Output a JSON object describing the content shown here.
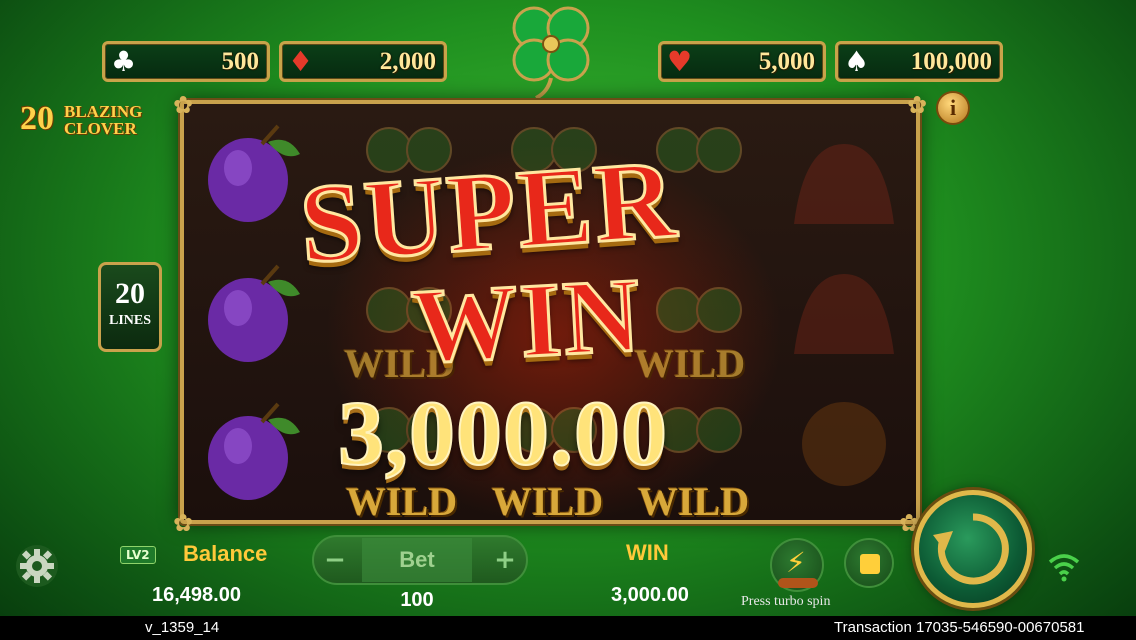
{
  "jackpots": [
    {
      "suit": "club-icon",
      "glyph": "♣",
      "color": "#ffffff",
      "value": "500"
    },
    {
      "suit": "diamond-icon",
      "glyph": "♦",
      "color": "#e53a2a",
      "value": "2,000"
    },
    {
      "suit": "heart-icon",
      "glyph": "♥",
      "color": "#e53a2a",
      "value": "5,000"
    },
    {
      "suit": "spade-icon",
      "glyph": "♠",
      "color": "#ffffff",
      "value": "100,000"
    }
  ],
  "logo": {
    "number": "20",
    "line1": "BLAZING",
    "line2": "CLOVER"
  },
  "lines": {
    "number": "20",
    "label": "LINES"
  },
  "info_label": "i",
  "reels": {
    "wild_labels": [
      "WILD",
      "WILD",
      "WILD",
      "WILD",
      "WILD",
      "WILD"
    ]
  },
  "win_overlay": {
    "line1": "SUPER",
    "line2": "WIN",
    "amount": "3,000.00"
  },
  "bottom": {
    "level": "LV2",
    "balance_label": "Balance",
    "balance": "16,498.00",
    "bet_label": "Bet",
    "bet_minus": "−",
    "bet_plus": "+",
    "bet": "100",
    "win_label": "WIN",
    "win": "3,000.00",
    "turbo_hint": "Press turbo spin"
  },
  "footer": {
    "version": "v_1359_14",
    "transaction": "Transaction 17035-546590-00670581"
  },
  "colors": {
    "accent_gold": "#c9a24c",
    "label_yellow": "#ffc93a",
    "super_red": "#e8281a"
  }
}
